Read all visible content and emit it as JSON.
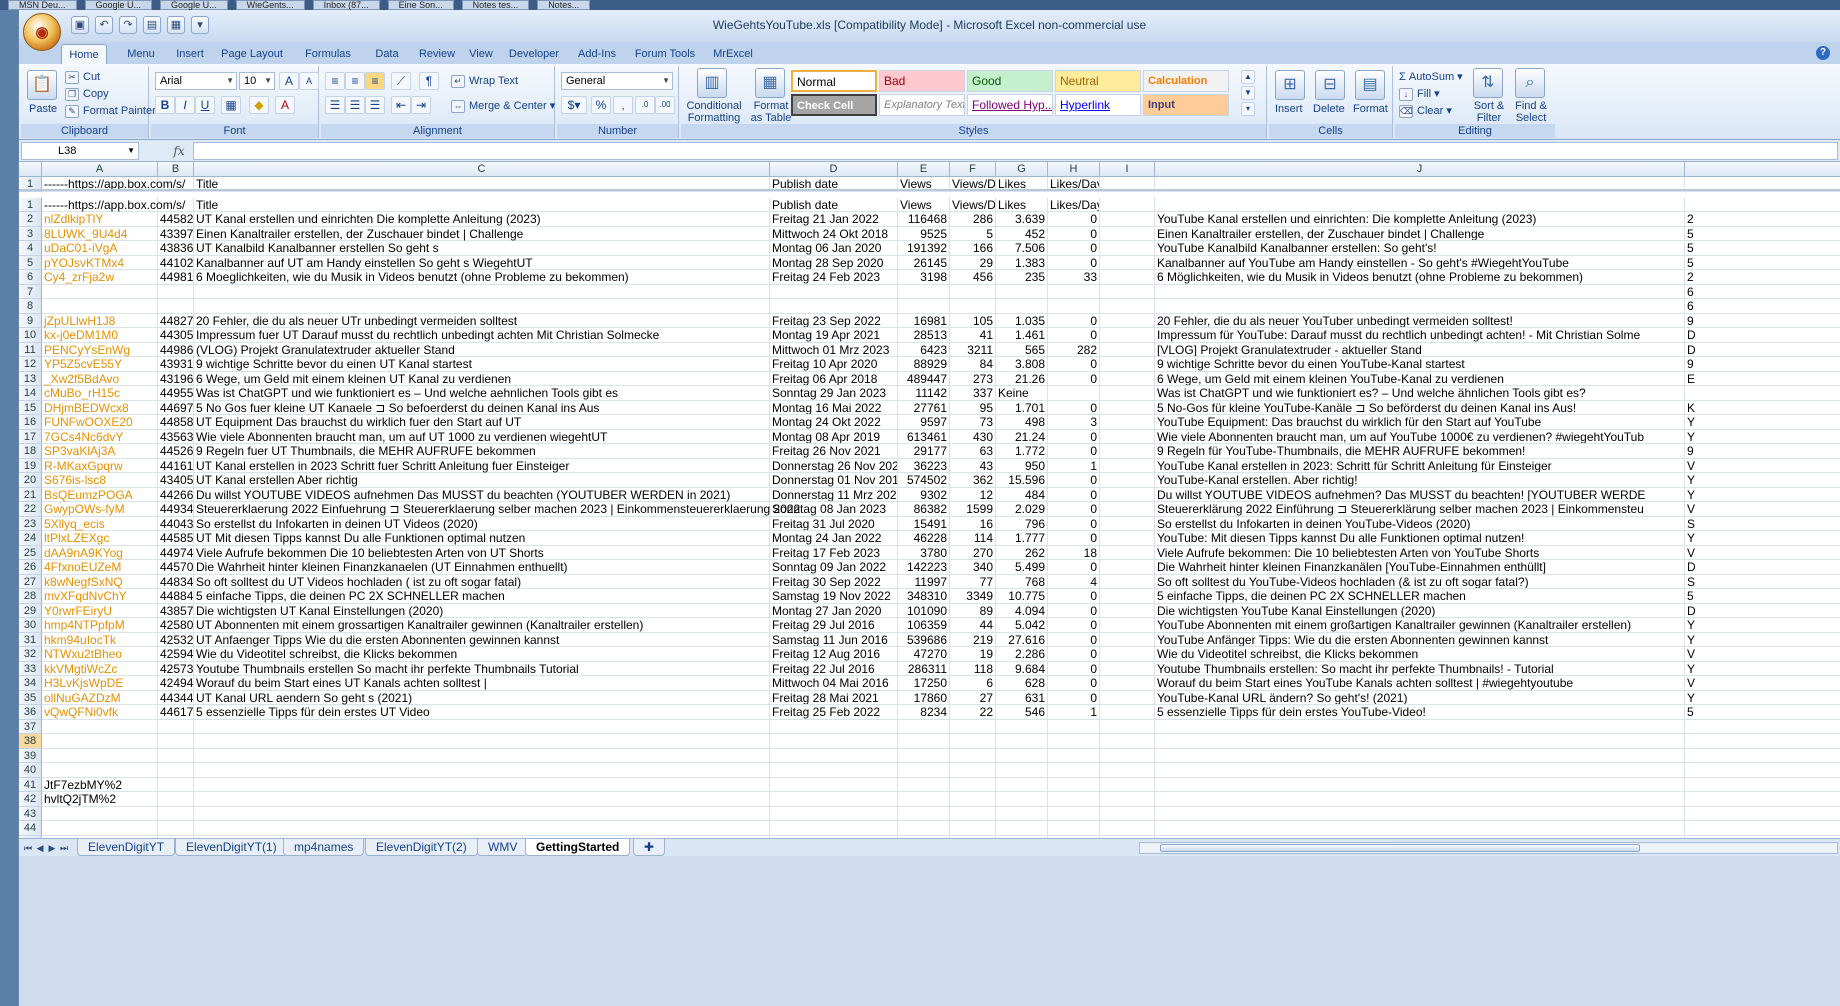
{
  "taskbar": [
    "MSN Deu...",
    "Google U...",
    "Google U...",
    "WieGents...",
    "Inbox (87...",
    "Eine Son...",
    "Notes tes...",
    "Notes..."
  ],
  "window": {
    "title": "WieGehtsYouTube.xls  [Compatibility Mode] - Microsoft Excel non-commercial use"
  },
  "ribbon_tabs": [
    "Home",
    "Menu",
    "Insert",
    "Page Layout",
    "Formulas",
    "Data",
    "Review",
    "View",
    "Developer",
    "Add-Ins",
    "Forum Tools",
    "MrExcel"
  ],
  "ribbon": {
    "clipboard": {
      "paste": "Paste",
      "cut": "Cut",
      "copy": "Copy",
      "format_painter": "Format Painter",
      "label": "Clipboard"
    },
    "font": {
      "name": "Arial",
      "size": "10",
      "label": "Font"
    },
    "alignment": {
      "wrap": "Wrap Text",
      "merge": "Merge & Center",
      "label": "Alignment"
    },
    "number": {
      "format": "General",
      "label": "Number"
    },
    "styles": {
      "conditional": "Conditional Formatting",
      "format_table": "Format as Table",
      "cells": [
        {
          "name": "Normal",
          "bg": "#ffffff",
          "fg": "#000000"
        },
        {
          "name": "Bad",
          "bg": "#ffc7ce",
          "fg": "#9c0006"
        },
        {
          "name": "Good",
          "bg": "#c6efce",
          "fg": "#006100"
        },
        {
          "name": "Neutral",
          "bg": "#ffeb9c",
          "fg": "#9c6500"
        },
        {
          "name": "Calculation",
          "bg": "#f2f2f2",
          "fg": "#fa7d00"
        },
        {
          "name": "Check Cell",
          "bg": "#a5a5a5",
          "fg": "#ffffff"
        },
        {
          "name": "Explanatory Text",
          "bg": "#ffffff",
          "fg": "#7f7f7f"
        },
        {
          "name": "Followed Hyp...",
          "bg": "#ffffff",
          "fg": "#800080"
        },
        {
          "name": "Hyperlink",
          "bg": "#ffffff",
          "fg": "#0000ff"
        },
        {
          "name": "Input",
          "bg": "#ffcc99",
          "fg": "#3f3f76"
        }
      ],
      "label": "Styles"
    },
    "cells": {
      "insert": "Insert",
      "delete": "Delete",
      "format": "Format",
      "label": "Cells"
    },
    "editing": {
      "autosum": "AutoSum",
      "fill": "Fill",
      "clear": "Clear",
      "sort": "Sort & Filter",
      "find": "Find & Select",
      "label": "Editing"
    }
  },
  "formula_bar": {
    "name_box": "L38",
    "formula": ""
  },
  "columns": [
    "A",
    "B",
    "C",
    "D",
    "E",
    "F",
    "G",
    "H",
    "I",
    "J"
  ],
  "rows": [
    {
      "n": "1",
      "A": "------https://app.box.com/s/",
      "B": "",
      "C": "Title",
      "D": "Publish date",
      "E": "Views",
      "F": "Views/Day",
      "G": "Likes",
      "H": "Likes/Day",
      "J": ""
    },
    {
      "n": "1",
      "A": "------https://app.box.com/s/",
      "B": "",
      "C": "Title",
      "D": "Publish date",
      "E": "Views",
      "F": "Views/Day",
      "G": "Likes",
      "H": "Likes/Day",
      "J": ""
    },
    {
      "n": "2",
      "A": "nlZdlkipTlY",
      "B": "44582",
      "C": "UT Kanal erstellen und einrichten Die komplette Anleitung (2023)",
      "D": "Freitag 21 Jan 2022",
      "E": "116468",
      "F": "286",
      "G": "3.639",
      "H": "0",
      "J": "YouTube Kanal erstellen und einrichten: Die komplette Anleitung (2023)"
    },
    {
      "n": "3",
      "A": "8LUWK_9U4d4",
      "B": "43397",
      "C": "Einen Kanaltrailer erstellen, der Zuschauer bindet | Challenge",
      "D": "Mittwoch 24 Okt 2018",
      "E": "9525",
      "F": "5",
      "G": "452",
      "H": "0",
      "J": "Einen Kanaltrailer erstellen, der Zuschauer bindet | Challenge"
    },
    {
      "n": "4",
      "A": "uDaC01-iVgA",
      "B": "43836",
      "C": "UT Kanalbild Kanalbanner erstellen So geht s",
      "D": "Montag 06 Jan 2020",
      "E": "191392",
      "F": "166",
      "G": "7.506",
      "H": "0",
      "J": "YouTube Kanalbild Kanalbanner erstellen: So geht's!"
    },
    {
      "n": "5",
      "A": "pYOJsvKTMx4",
      "B": "44102",
      "C": "Kanalbanner auf UT am Handy einstellen So geht s WiegehtUT",
      "D": "Montag 28 Sep 2020",
      "E": "26145",
      "F": "29",
      "G": "1.383",
      "H": "0",
      "J": "Kanalbanner auf YouTube am Handy einstellen - So geht's #WiegehtYouTube"
    },
    {
      "n": "6",
      "A": "Cy4_zrFja2w",
      "B": "44981",
      "C": "6 Moeglichkeiten, wie du Musik in Videos benutzt (ohne Probleme zu bekommen)",
      "D": "Freitag 24 Feb 2023",
      "E": "3198",
      "F": "456",
      "G": "235",
      "H": "33",
      "J": "6 Möglichkeiten, wie du Musik in Videos benutzt (ohne Probleme zu bekommen)"
    },
    {
      "n": "7",
      "A": "",
      "B": "",
      "C": "",
      "D": "",
      "E": "",
      "F": "",
      "G": "",
      "H": "",
      "J": ""
    },
    {
      "n": "8",
      "A": "",
      "B": "",
      "C": "",
      "D": "",
      "E": "",
      "F": "",
      "G": "",
      "H": "",
      "J": ""
    },
    {
      "n": "9",
      "A": "jZpULlwH1J8",
      "B": "44827",
      "C": "20 Fehler, die du als neuer UTr unbedingt vermeiden solltest",
      "D": "Freitag 23 Sep 2022",
      "E": "16981",
      "F": "105",
      "G": "1.035",
      "H": "0",
      "J": "20 Fehler, die du als neuer YouTuber unbedingt vermeiden solltest!"
    },
    {
      "n": "10",
      "A": "kx-j0eDM1M0",
      "B": "44305",
      "C": "Impressum fuer UT Darauf musst du rechtlich unbedingt achten Mit Christian Solmecke",
      "D": "Montag 19 Apr 2021",
      "E": "28513",
      "F": "41",
      "G": "1.461",
      "H": "0",
      "J": "Impressum für YouTube: Darauf musst du rechtlich unbedingt achten! - Mit Christian Solme"
    },
    {
      "n": "11",
      "A": "PENCyYsEnWg",
      "B": "44986",
      "C": "(VLOG) Projekt Granulatextruder aktueller Stand",
      "D": "Mittwoch 01 Mrz 2023",
      "E": "6423",
      "F": "3211",
      "G": "565",
      "H": "282",
      "J": "[VLOG] Projekt Granulatextruder - aktueller Stand"
    },
    {
      "n": "12",
      "A": "YP5Z5cvE55Y",
      "B": "43931",
      "C": "9 wichtige Schritte bevor du einen UT Kanal startest",
      "D": "Freitag 10 Apr 2020",
      "E": "88929",
      "F": "84",
      "G": "3.808",
      "H": "0",
      "J": "9 wichtige Schritte bevor du einen YouTube-Kanal startest"
    },
    {
      "n": "13",
      "A": "_Xw2f5BdAvo",
      "B": "43196",
      "C": "6 Wege, um Geld mit einem kleinen UT Kanal zu verdienen",
      "D": "Freitag 06 Apr 2018",
      "E": "489447",
      "F": "273",
      "G": "21.26",
      "H": "0",
      "J": "6 Wege, um Geld mit einem kleinen YouTube-Kanal zu verdienen"
    },
    {
      "n": "14",
      "A": "cMuBo_rH15c",
      "B": "44955",
      "C": "Was ist ChatGPT und wie funktioniert es – Und welche aehnlichen Tools gibt es",
      "D": "Sonntag 29 Jan 2023",
      "E": "11142",
      "F": "337",
      "G": "Keine",
      "H": "",
      "J": "Was ist ChatGPT und wie funktioniert es? – Und welche ähnlichen Tools gibt es?"
    },
    {
      "n": "15",
      "A": "DHjmBEDWcx8",
      "B": "44697",
      "C": "5 No Gos fuer kleine UT Kanaele ⊐ So befoerderst du deinen Kanal ins Aus",
      "D": "Montag 16 Mai 2022",
      "E": "27761",
      "F": "95",
      "G": "1.701",
      "H": "0",
      "J": "5 No-Gos für kleine YouTube-Kanäle ⊐ So beförderst du deinen Kanal ins Aus!"
    },
    {
      "n": "16",
      "A": "FUNFwOOXE20",
      "B": "44858",
      "C": "UT Equipment Das brauchst du wirklich fuer den Start auf UT",
      "D": "Montag 24 Okt 2022",
      "E": "9597",
      "F": "73",
      "G": "498",
      "H": "3",
      "J": "YouTube Equipment: Das brauchst du wirklich für den Start auf YouTube"
    },
    {
      "n": "17",
      "A": "7GCs4Nc6dvY",
      "B": "43563",
      "C": "Wie viele Abonnenten braucht man, um auf UT 1000 zu verdienen wiegehtUT",
      "D": "Montag 08 Apr 2019",
      "E": "613461",
      "F": "430",
      "G": "21.24",
      "H": "0",
      "J": "Wie viele Abonnenten braucht man, um auf YouTube 1000€ zu verdienen? #wiegehtYouTub"
    },
    {
      "n": "18",
      "A": "SP3vaKlAj3A",
      "B": "44526",
      "C": "9 Regeln fuer UT Thumbnails, die MEHR AUFRUFE bekommen",
      "D": "Freitag 26 Nov 2021",
      "E": "29177",
      "F": "63",
      "G": "1.772",
      "H": "0",
      "J": "9 Regeln für YouTube-Thumbnails, die MEHR AUFRUFE bekommen!"
    },
    {
      "n": "19",
      "A": "R-MKaxGpqrw",
      "B": "44161",
      "C": "UT Kanal erstellen in 2023 Schritt fuer Schritt Anleitung fuer Einsteiger",
      "D": "Donnerstag 26 Nov 2020",
      "E": "36223",
      "F": "43",
      "G": "950",
      "H": "1",
      "J": "YouTube Kanal erstellen in 2023: Schritt für Schritt Anleitung für Einsteiger"
    },
    {
      "n": "20",
      "A": "S676is-lsc8",
      "B": "43405",
      "C": "UT Kanal erstellen Aber richtig",
      "D": "Donnerstag 01 Nov 2018",
      "E": "574502",
      "F": "362",
      "G": "15.596",
      "H": "0",
      "J": "YouTube-Kanal erstellen. Aber richtig!"
    },
    {
      "n": "21",
      "A": "BsQEumzPOGA",
      "B": "44266",
      "C": "Du willst YOUTUBE VIDEOS aufnehmen Das MUSST du beachten (YOUTUBER WERDEN in 2021)",
      "D": "Donnerstag 11 Mrz 2021",
      "E": "9302",
      "F": "12",
      "G": "484",
      "H": "0",
      "J": "Du willst YOUTUBE VIDEOS aufnehmen? Das MUSST du beachten! [YOUTUBER WERDE"
    },
    {
      "n": "22",
      "A": "GwypOWs-fyM",
      "B": "44934",
      "C": "Steuererklaerung 2022 Einfuehrung ⊐ Steuererklaerung selber machen 2023 | Einkommensteuererklaerung 2022",
      "D": "Sonntag 08 Jan 2023",
      "E": "86382",
      "F": "1599",
      "G": "2.029",
      "H": "0",
      "J": "Steuererklärung 2022 Einführung ⊐ Steuererklärung selber machen 2023 | Einkommensteu"
    },
    {
      "n": "23",
      "A": "5Xllyq_ecis",
      "B": "44043",
      "C": "So erstellst du Infokarten in deinen UT Videos (2020)",
      "D": "Freitag 31 Jul 2020",
      "E": "15491",
      "F": "16",
      "G": "796",
      "H": "0",
      "J": "So erstellst du Infokarten in deinen YouTube-Videos (2020)"
    },
    {
      "n": "24",
      "A": "ltPlxLZEXgc",
      "B": "44585",
      "C": "UT Mit diesen Tipps kannst Du alle Funktionen optimal nutzen",
      "D": "Montag 24 Jan 2022",
      "E": "46228",
      "F": "114",
      "G": "1.777",
      "H": "0",
      "J": "YouTube: Mit diesen Tipps kannst Du alle Funktionen optimal nutzen!"
    },
    {
      "n": "25",
      "A": "dAA9nA9KYog",
      "B": "44974",
      "C": "Viele Aufrufe bekommen Die 10 beliebtesten Arten von UT Shorts",
      "D": "Freitag 17 Feb 2023",
      "E": "3780",
      "F": "270",
      "G": "262",
      "H": "18",
      "J": "Viele Aufrufe bekommen: Die 10 beliebtesten Arten von YouTube Shorts"
    },
    {
      "n": "26",
      "A": "4FfxnoEUZeM",
      "B": "44570",
      "C": "Die Wahrheit hinter kleinen Finanzkanaelen (UT Einnahmen enthuellt)",
      "D": "Sonntag 09 Jan 2022",
      "E": "142223",
      "F": "340",
      "G": "5.499",
      "H": "0",
      "J": "Die Wahrheit hinter kleinen Finanzkanälen [YouTube-Einnahmen enthüllt]"
    },
    {
      "n": "27",
      "A": "k8wNegfSxNQ",
      "B": "44834",
      "C": "So oft solltest du UT Videos hochladen ( ist zu oft sogar fatal)",
      "D": "Freitag 30 Sep 2022",
      "E": "11997",
      "F": "77",
      "G": "768",
      "H": "4",
      "J": "So oft solltest du YouTube-Videos hochladen (& ist zu oft sogar fatal?)"
    },
    {
      "n": "28",
      "A": "mvXFqdNvChY",
      "B": "44884",
      "C": "5 einfache Tipps, die deinen PC 2X SCHNELLER machen",
      "D": "Samstag 19 Nov 2022",
      "E": "348310",
      "F": "3349",
      "G": "10.775",
      "H": "0",
      "J": "5 einfache Tipps, die deinen PC 2X SCHNELLER machen"
    },
    {
      "n": "29",
      "A": "Y0rwrFEiryU",
      "B": "43857",
      "C": "Die wichtigsten UT Kanal Einstellungen (2020)",
      "D": "Montag 27 Jan 2020",
      "E": "101090",
      "F": "89",
      "G": "4.094",
      "H": "0",
      "J": "Die wichtigsten YouTube Kanal Einstellungen (2020)"
    },
    {
      "n": "30",
      "A": "hmp4NTPpfpM",
      "B": "42580",
      "C": "UT Abonnenten mit einem grossartigen Kanaltrailer gewinnen (Kanaltrailer erstellen)",
      "D": "Freitag 29 Jul 2016",
      "E": "106359",
      "F": "44",
      "G": "5.042",
      "H": "0",
      "J": "YouTube Abonnenten mit einem großartigen Kanaltrailer gewinnen (Kanaltrailer erstellen)"
    },
    {
      "n": "31",
      "A": "hkm94uIocTk",
      "B": "42532",
      "C": "UT Anfaenger Tipps Wie du die ersten Abonnenten gewinnen kannst",
      "D": "Samstag 11 Jun 2016",
      "E": "539686",
      "F": "219",
      "G": "27.616",
      "H": "0",
      "J": "YouTube Anfänger Tipps: Wie du die ersten Abonnenten gewinnen kannst"
    },
    {
      "n": "32",
      "A": "NTWxu2tBheo",
      "B": "42594",
      "C": "Wie du Videotitel schreibst, die Klicks bekommen",
      "D": "Freitag 12 Aug 2016",
      "E": "47270",
      "F": "19",
      "G": "2.286",
      "H": "0",
      "J": "Wie du Videotitel schreibst, die Klicks bekommen"
    },
    {
      "n": "33",
      "A": "kkVMgtiWcZc",
      "B": "42573",
      "C": "Youtube Thumbnails erstellen So macht ihr perfekte Thumbnails Tutorial",
      "D": "Freitag 22 Jul 2016",
      "E": "286311",
      "F": "118",
      "G": "9.684",
      "H": "0",
      "J": "Youtube Thumbnails erstellen: So macht ihr perfekte Thumbnails! - Tutorial"
    },
    {
      "n": "34",
      "A": "H3LvKjsWpDE",
      "B": "42494",
      "C": "Worauf du beim Start eines UT Kanals achten solltest |",
      "D": "Mittwoch 04 Mai 2016",
      "E": "17250",
      "F": "6",
      "G": "628",
      "H": "0",
      "J": "Worauf du beim Start eines YouTube Kanals achten solltest | #wiegehtyoutube"
    },
    {
      "n": "35",
      "A": "ollNuGAZDzM",
      "B": "44344",
      "C": "UT Kanal URL aendern So geht s (2021)",
      "D": "Freitag 28 Mai 2021",
      "E": "17860",
      "F": "27",
      "G": "631",
      "H": "0",
      "J": "YouTube-Kanal URL ändern? So geht's! (2021)"
    },
    {
      "n": "36",
      "A": "vQwQFNi0vfk",
      "B": "44617",
      "C": "5 essenzielle Tipps für dein erstes UT Video",
      "D": "Freitag 25 Feb 2022",
      "E": "8234",
      "F": "22",
      "G": "546",
      "H": "1",
      "J": "5 essenzielle Tipps für dein erstes YouTube-Video!"
    },
    {
      "n": "37",
      "A": "",
      "B": "",
      "C": "",
      "D": "",
      "E": "",
      "F": "",
      "G": "",
      "H": "",
      "J": ""
    },
    {
      "n": "38",
      "A": "",
      "B": "",
      "C": "",
      "D": "",
      "E": "",
      "F": "",
      "G": "",
      "H": "",
      "J": ""
    },
    {
      "n": "39",
      "A": "",
      "B": "",
      "C": "",
      "D": "",
      "E": "",
      "F": "",
      "G": "",
      "H": "",
      "J": ""
    },
    {
      "n": "40",
      "A": "",
      "B": "",
      "C": "",
      "D": "",
      "E": "",
      "F": "",
      "G": "",
      "H": "",
      "J": ""
    },
    {
      "n": "41",
      "A": "JtF7ezbMY%2",
      "B": "",
      "C": "",
      "D": "",
      "E": "",
      "F": "",
      "G": "",
      "H": "",
      "J": ""
    },
    {
      "n": "42",
      "A": "hvltQ2jTM%2",
      "B": "",
      "C": "",
      "D": "",
      "E": "",
      "F": "",
      "G": "",
      "H": "",
      "J": ""
    },
    {
      "n": "43",
      "A": "",
      "B": "",
      "C": "",
      "D": "",
      "E": "",
      "F": "",
      "G": "",
      "H": "",
      "J": ""
    },
    {
      "n": "44",
      "A": "",
      "B": "",
      "C": "",
      "D": "",
      "E": "",
      "F": "",
      "G": "",
      "H": "",
      "J": ""
    },
    {
      "n": "45",
      "A": "",
      "B": "",
      "C": "",
      "D": "",
      "E": "",
      "F": "",
      "G": "",
      "H": "",
      "J": ""
    }
  ],
  "right_edge_chars": [
    "",
    "",
    "2",
    "5",
    "5",
    "5",
    "2",
    "6",
    "6",
    "9",
    "D",
    "D",
    "9",
    "E",
    "",
    "K",
    "Y",
    "Y",
    "9",
    "V",
    "Y",
    "Y",
    "V",
    "S",
    "Y",
    "V",
    "D",
    "S",
    "5",
    "D",
    "Y",
    "Y",
    "V",
    "Y",
    "V",
    "Y",
    "5"
  ],
  "sheets": [
    "ElevenDigitYT",
    "ElevenDigitYT(1)",
    "mp4names",
    "ElevenDigitYT(2)",
    "WMV",
    "GettingStarted"
  ],
  "active_sheet": "GettingStarted",
  "selected_row": "38",
  "selected_col": "L"
}
